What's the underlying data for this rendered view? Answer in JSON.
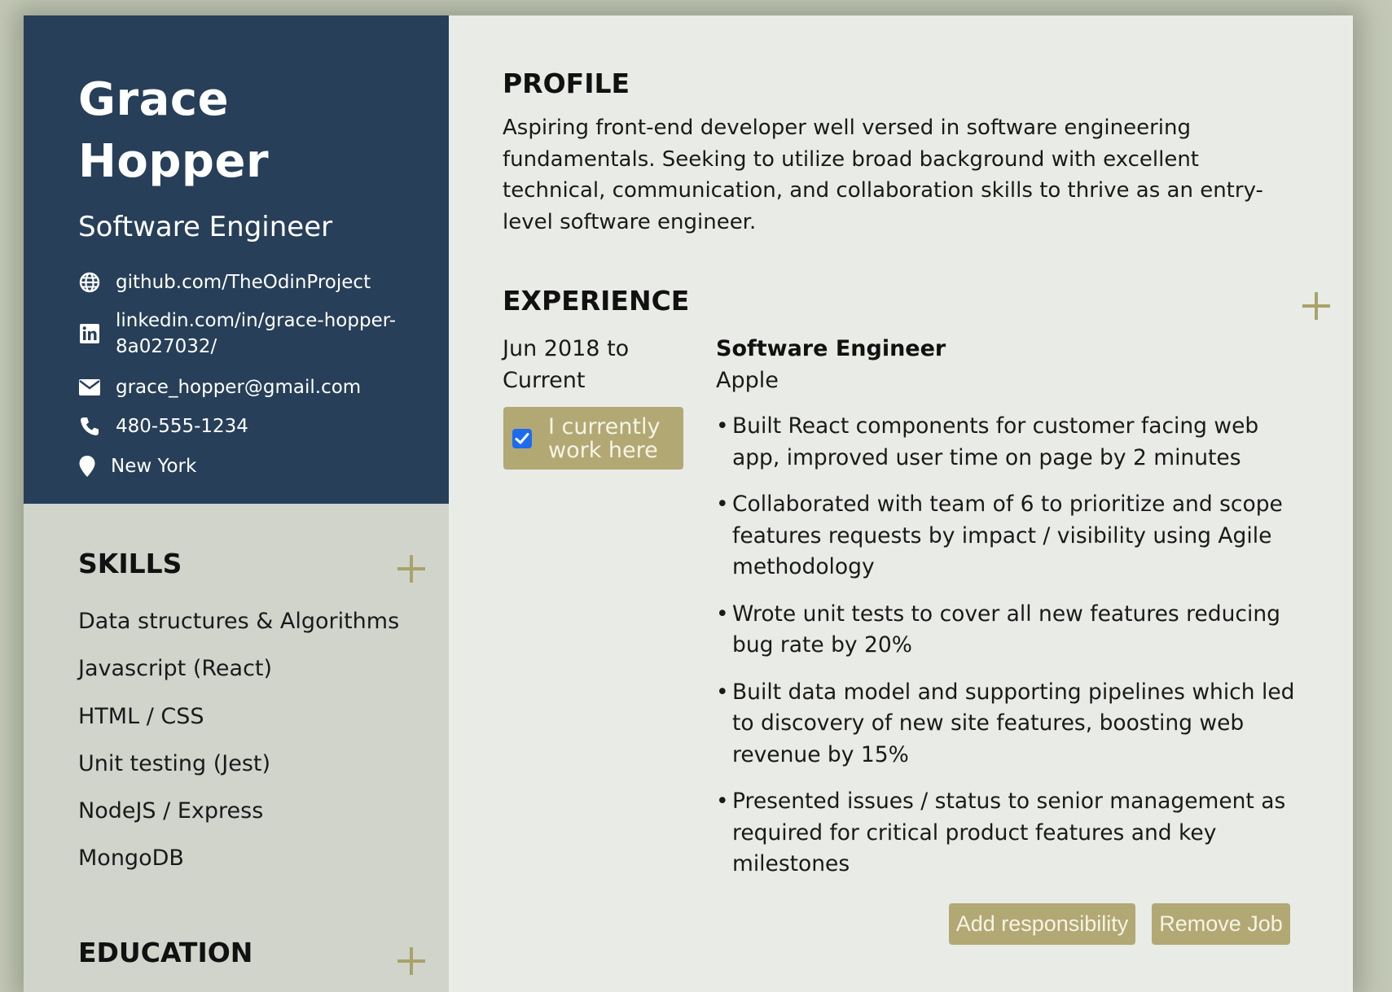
{
  "header": {
    "name": "Grace Hopper",
    "job_title": "Software Engineer"
  },
  "contacts": [
    {
      "icon": "globe-icon",
      "text": "github.com/TheOdinProject"
    },
    {
      "icon": "linkedin-icon",
      "text": "linkedin.com/in/grace-hopper-8a027032/"
    },
    {
      "icon": "envelope-icon",
      "text": "grace_hopper@gmail.com"
    },
    {
      "icon": "phone-icon",
      "text": "480-555-1234"
    },
    {
      "icon": "map-pin-icon",
      "text": "New York"
    }
  ],
  "skills": {
    "heading": "SKILLS",
    "items": [
      "Data structures & Algorithms",
      "Javascript (React)",
      "HTML / CSS",
      "Unit testing (Jest)",
      "NodeJS / Express",
      "MongoDB"
    ]
  },
  "education": {
    "heading": "EDUCATION"
  },
  "profile": {
    "heading": "PROFILE",
    "text": "Aspiring front-end developer well versed in software engineering fundamentals. Seeking to utilize broad background with excellent technical, communication, and collaboration skills to thrive as an entry-level software engineer."
  },
  "experience": {
    "heading": "EXPERIENCE",
    "jobs": [
      {
        "dates": "Jun 2018 to Current",
        "current_label": "I currently work here",
        "current_checked": true,
        "title": "Software Engineer",
        "company": "Apple",
        "responsibilities": [
          "Built React components for customer facing web app, improved user time on page by 2 minutes",
          "Collaborated with team of 6 to prioritize and scope features requests by impact / visibility using Agile methodology",
          "Wrote unit tests to cover all new features reducing bug rate by 20%",
          "Built data model and supporting pipelines which led to discovery of new site features, boosting web revenue by 15%",
          "Presented issues / status to senior management as required for critical product features and key milestones"
        ],
        "add_label": "Add responsibility",
        "remove_label": "Remove Job"
      }
    ]
  },
  "colors": {
    "header_bg": "#273f58",
    "sidebar_bg": "#d0d4cb",
    "main_bg": "#e9ebe6",
    "accent": "#b2a874",
    "plus": "#a9a36b",
    "checkbox": "#1d6cf0"
  }
}
